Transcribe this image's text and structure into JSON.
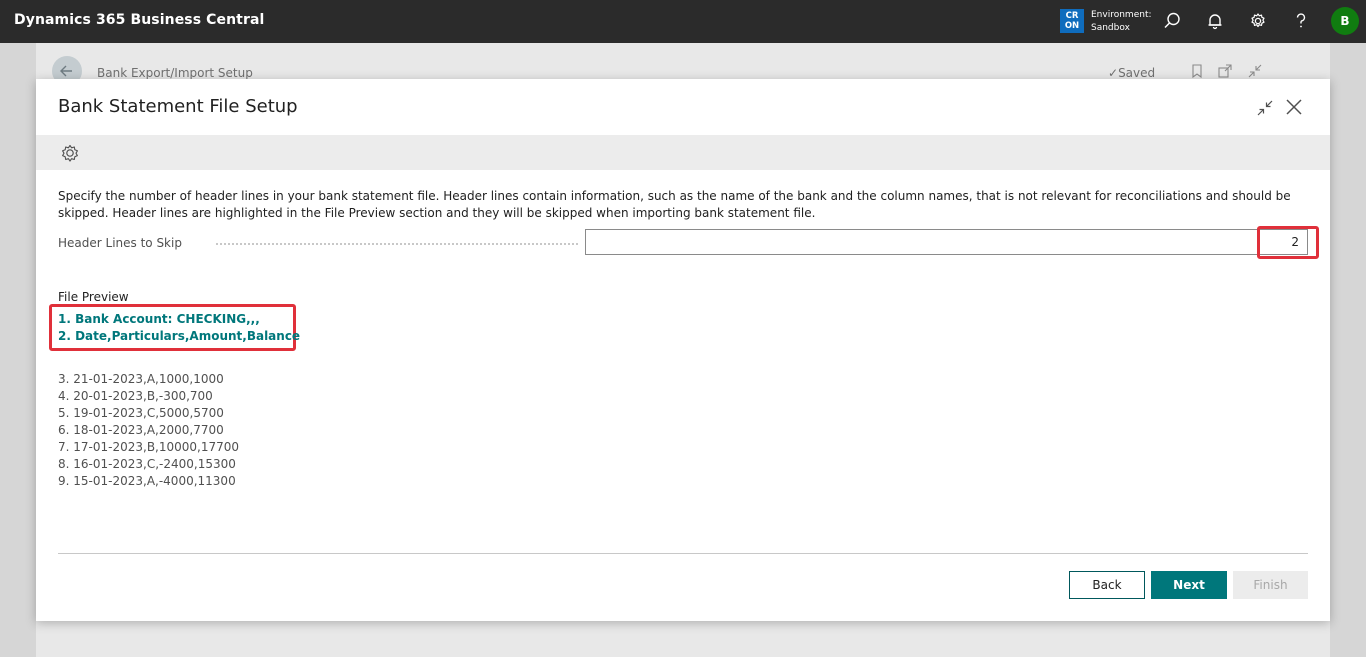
{
  "topbar": {
    "app_title": "Dynamics 365 Business Central",
    "env_badge": "CR ON",
    "env_label": "Environment:",
    "env_name": "Sandbox",
    "avatar_initial": "B",
    "icons": [
      "search-icon",
      "bell-icon",
      "gear-icon",
      "help-icon"
    ]
  },
  "background_page": {
    "breadcrumb": "Bank Export/Import Setup",
    "saved_label": "Saved"
  },
  "dialog": {
    "title": "Bank Statement File Setup",
    "instruction": "Specify the number of header lines in your bank statement file. Header lines contain information, such as the name of the bank and the column names, that is not relevant for reconciliations and should be skipped. Header lines are highlighted in the File Preview section and they will be skipped when importing bank statement file.",
    "field": {
      "label": "Header Lines to Skip",
      "value": "2"
    },
    "preview": {
      "label": "File Preview",
      "header_lines": [
        "1.  Bank Account: CHECKING,,,",
        "2.  Date,Particulars,Amount,Balance"
      ],
      "data_lines": [
        "3.  21-01-2023,A,1000,1000",
        "4.  20-01-2023,B,-300,700",
        "5.  19-01-2023,C,5000,5700",
        "6.  18-01-2023,A,2000,7700",
        "7.  17-01-2023,B,10000,17700",
        "8.  16-01-2023,C,-2400,15300",
        "9.  15-01-2023,A,-4000,11300"
      ]
    },
    "buttons": {
      "back": "Back",
      "next": "Next",
      "finish": "Finish"
    }
  },
  "colors": {
    "accent": "#00777b",
    "highlight": "#e0303a",
    "topbar": "#2b2b2b"
  }
}
